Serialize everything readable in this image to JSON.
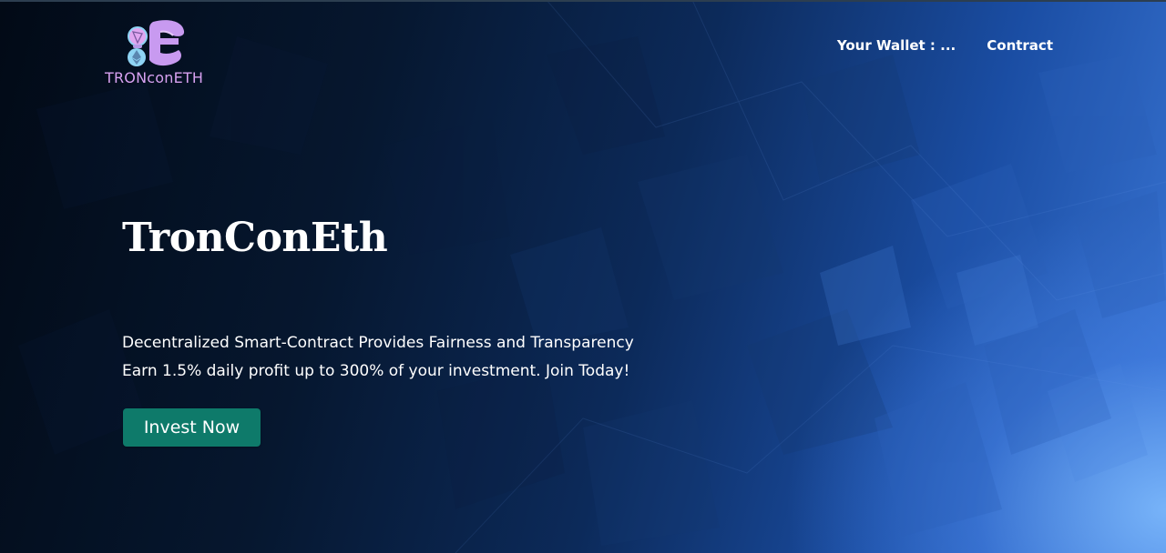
{
  "brand": {
    "logo_text": "TRONconETH",
    "colors": {
      "logo_text": "#d7a1f0",
      "logo_e": "#c89af0",
      "logo_coin": "#8fd4f4"
    }
  },
  "nav": {
    "items": [
      {
        "label": "Your Wallet : ..."
      },
      {
        "label": "Contract"
      }
    ]
  },
  "hero": {
    "title": "TronConEth",
    "line1": "Decentralized Smart-Contract Provides Fairness and Transparency",
    "line2": "Earn 1.5% daily profit up to 300% of your investment. Join Today!",
    "cta_label": "Invest Now",
    "cta_color": "#0e7a6a"
  }
}
